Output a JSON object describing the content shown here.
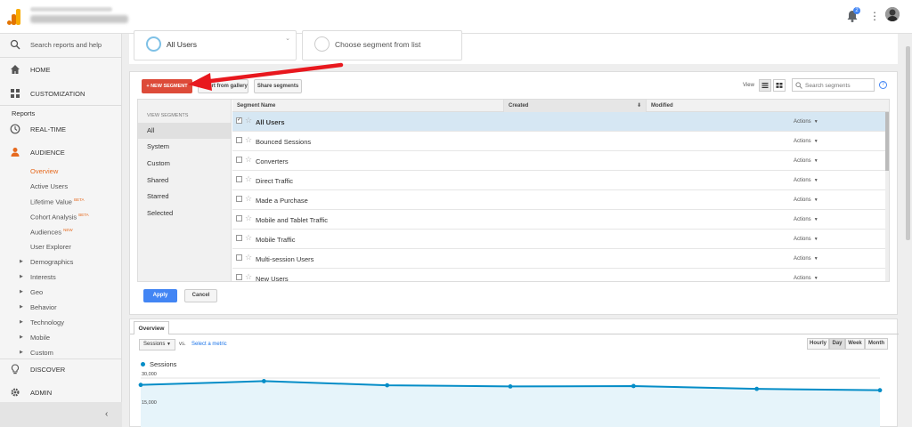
{
  "topbar": {
    "notification_count": "2"
  },
  "sidebar": {
    "search_label": "Search reports and help",
    "home": "HOME",
    "customization": "CUSTOMIZATION",
    "reports_header": "Reports",
    "realtime": "REAL-TIME",
    "audience": "AUDIENCE",
    "audience_items": [
      {
        "label": "Overview",
        "badge": ""
      },
      {
        "label": "Active Users",
        "badge": ""
      },
      {
        "label": "Lifetime Value",
        "badge": "BETA"
      },
      {
        "label": "Cohort Analysis",
        "badge": "BETA"
      },
      {
        "label": "Audiences",
        "badge": "NEW"
      },
      {
        "label": "User Explorer",
        "badge": ""
      }
    ],
    "expandable_items": [
      "Demographics",
      "Interests",
      "Geo",
      "Behavior",
      "Technology",
      "Mobile",
      "Custom"
    ],
    "discover": "DISCOVER",
    "admin": "ADMIN",
    "collapse_icon": "chevron-left-icon"
  },
  "segments": {
    "selected_segment": "All Users",
    "choose_placeholder": "Choose segment from list",
    "new_segment_label": "+ NEW SEGMENT",
    "import_label": "Import from gallery",
    "share_label": "Share segments",
    "view_label": "View",
    "search_placeholder": "Search segments",
    "help_label": "?",
    "view_segments_title": "VIEW SEGMENTS",
    "filters": [
      "All",
      "System",
      "Custom",
      "Shared",
      "Starred",
      "Selected"
    ],
    "columns": {
      "name": "Segment Name",
      "created": "Created",
      "modified": "Modified"
    },
    "rows": [
      {
        "name": "All Users",
        "checked": true
      },
      {
        "name": "Bounced Sessions",
        "checked": false
      },
      {
        "name": "Converters",
        "checked": false
      },
      {
        "name": "Direct Traffic",
        "checked": false
      },
      {
        "name": "Made a Purchase",
        "checked": false
      },
      {
        "name": "Mobile and Tablet Traffic",
        "checked": false
      },
      {
        "name": "Mobile Traffic",
        "checked": false
      },
      {
        "name": "Multi-session Users",
        "checked": false
      },
      {
        "name": "New Users",
        "checked": false
      }
    ],
    "actions_label": "Actions",
    "apply_label": "Apply",
    "cancel_label": "Cancel"
  },
  "overview": {
    "tab_label": "Overview",
    "metric": "Sessions",
    "vs_label": "vs.",
    "select_metric": "Select a metric",
    "ranges": [
      "Hourly",
      "Day",
      "Week",
      "Month"
    ],
    "active_range": "Day"
  },
  "chart_data": {
    "type": "line",
    "series": [
      {
        "name": "Sessions",
        "values": [
          26400,
          28400,
          26200,
          25600,
          25800,
          24300,
          23600
        ]
      }
    ],
    "y_ticks": [
      "30,000",
      "15,000"
    ],
    "ylim": [
      0,
      30000
    ],
    "color": "#058dc7",
    "fill": "#e6f4fa"
  },
  "colors": {
    "accent_orange": "#e66a1f",
    "new_segment_red": "#dd4b39",
    "apply_blue": "#4285f4",
    "selected_row": "#d6e7f3"
  }
}
